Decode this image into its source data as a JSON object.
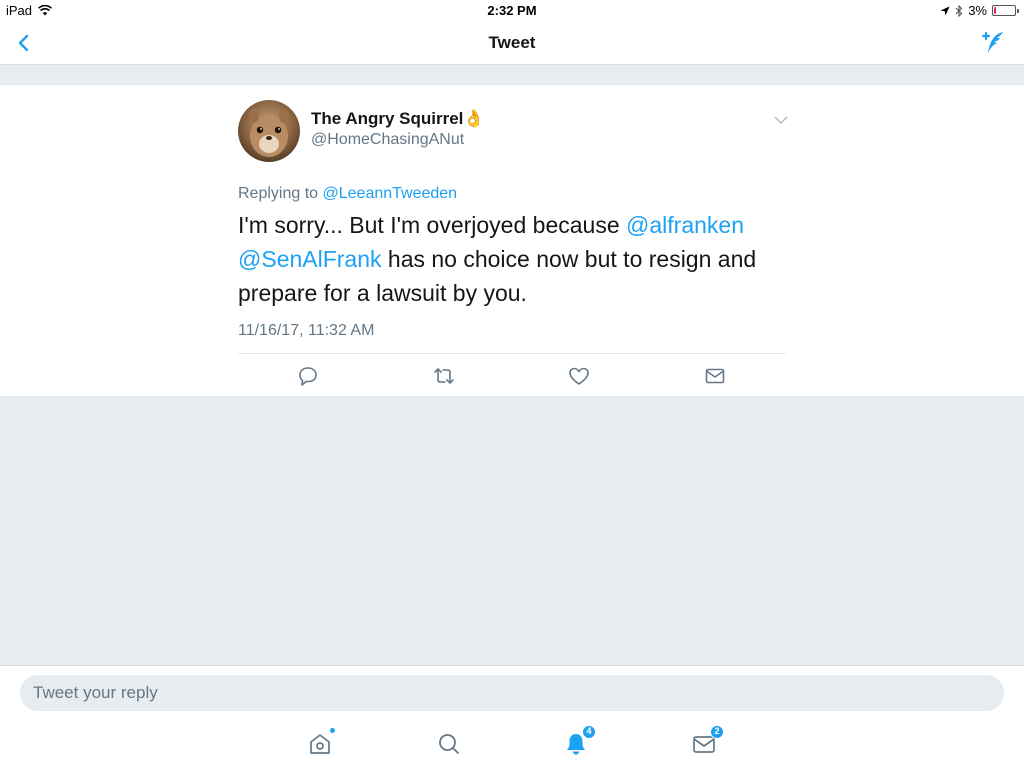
{
  "status_bar": {
    "device": "iPad",
    "time": "2:32 PM",
    "battery_percent": "3%",
    "battery_level": 0.03
  },
  "nav": {
    "title": "Tweet",
    "accent_color": "#1da1f2"
  },
  "tweet": {
    "author_name": "The Angry Squirrel",
    "author_emoji": "👌",
    "author_handle": "@HomeChasingANut",
    "replying_prefix": "Replying to",
    "replying_handle": "@LeeannTweeden",
    "text_parts": {
      "p1": "I'm sorry... But I'm overjoyed because ",
      "m1": "@alfranken",
      "m2": "@SenAlFrank",
      "p2": " has no choice now but to resign and prepare for a lawsuit by you."
    },
    "timestamp": "11/16/17, 11:32 AM",
    "actions": [
      "reply-icon",
      "retweet-icon",
      "like-icon",
      "dm-share-icon"
    ]
  },
  "reply_bar": {
    "placeholder": "Tweet your reply"
  },
  "tab_bar": {
    "tabs": [
      {
        "icon": "home-icon",
        "active": false,
        "has_dot": true
      },
      {
        "icon": "search-icon",
        "active": false
      },
      {
        "icon": "notifications-icon",
        "active": true,
        "badge": "4"
      },
      {
        "icon": "messages-icon",
        "active": false,
        "badge": "2"
      }
    ]
  }
}
